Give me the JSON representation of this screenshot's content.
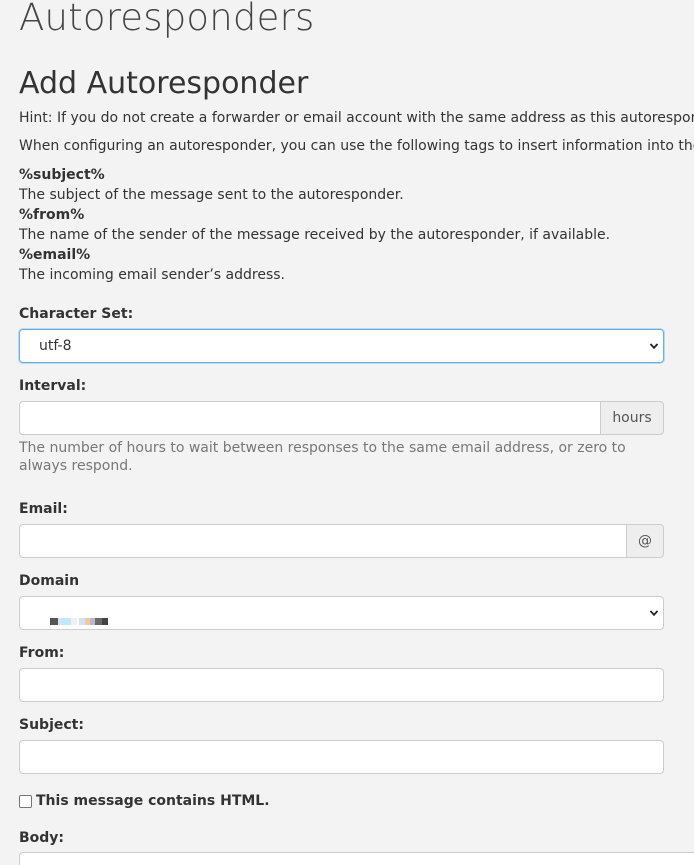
{
  "header": {
    "app_title": "Autoresponders",
    "section_title": "Add Autoresponder"
  },
  "intro": {
    "hint": "Hint: If you do not create a forwarder or email account with the same address as this autoresponder, ma",
    "tags_intro": "When configuring an autoresponder, you can use the following tags to insert information into the respo",
    "tags": [
      {
        "tag": "%subject%",
        "description": "The subject of the message sent to the autoresponder."
      },
      {
        "tag": "%from%",
        "description": "The name of the sender of the message received by the autoresponder, if available."
      },
      {
        "tag": "%email%",
        "description": "The incoming email sender’s address."
      }
    ]
  },
  "form": {
    "charset": {
      "label": "Character Set:",
      "selected": "utf-8"
    },
    "interval": {
      "label": "Interval:",
      "value": "",
      "addon": "hours",
      "help": "The number of hours to wait between responses to the same email address, or zero to always respond."
    },
    "email": {
      "label": "Email:",
      "value": "",
      "addon": "@"
    },
    "domain": {
      "label": "Domain",
      "selected": "",
      "redacted_colors": [
        "#555555",
        "#cfe6f2",
        "#bfe8f8",
        "#f0f0f0",
        "#cce4f4",
        "#f0c89c",
        "#b8b8c8",
        "#6a6a6a",
        "#444444"
      ]
    },
    "from": {
      "label": "From:",
      "value": ""
    },
    "subject": {
      "label": "Subject:",
      "value": ""
    },
    "html_checkbox": {
      "label": "This message contains HTML.",
      "checked": false
    },
    "body": {
      "label": "Body:",
      "value": ""
    }
  },
  "colors": {
    "focus_border": "#66afe9",
    "addon_bg": "#eeeeee",
    "page_bg": "#f3f3f3"
  }
}
